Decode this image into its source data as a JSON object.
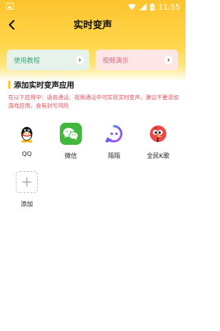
{
  "status": {
    "time": "11:55"
  },
  "header": {
    "title": "实时变声"
  },
  "cards": {
    "guide": {
      "label": "使用教程",
      "color": "#3aa97a",
      "bg": "#e6f3ec"
    },
    "video": {
      "label": "视频演示",
      "color": "#e0607a",
      "bg": "#fde6e6"
    }
  },
  "section": {
    "title": "添加实时变声应用",
    "description": "在以下应用中：语音通话、视频通话中可实现实时变声，建议不要添加游戏应用，会有封号风险"
  },
  "apps": [
    {
      "name": "QQ",
      "icon": "qq-icon"
    },
    {
      "name": "微信",
      "icon": "wechat-icon"
    },
    {
      "name": "陌陌",
      "icon": "momo-icon"
    },
    {
      "name": "全民K歌",
      "icon": "kge-icon"
    }
  ],
  "add": {
    "label": "添加",
    "icon": "plus-icon"
  },
  "colors": {
    "accent": "#ffc42e",
    "warning_text": "#e5505a"
  }
}
